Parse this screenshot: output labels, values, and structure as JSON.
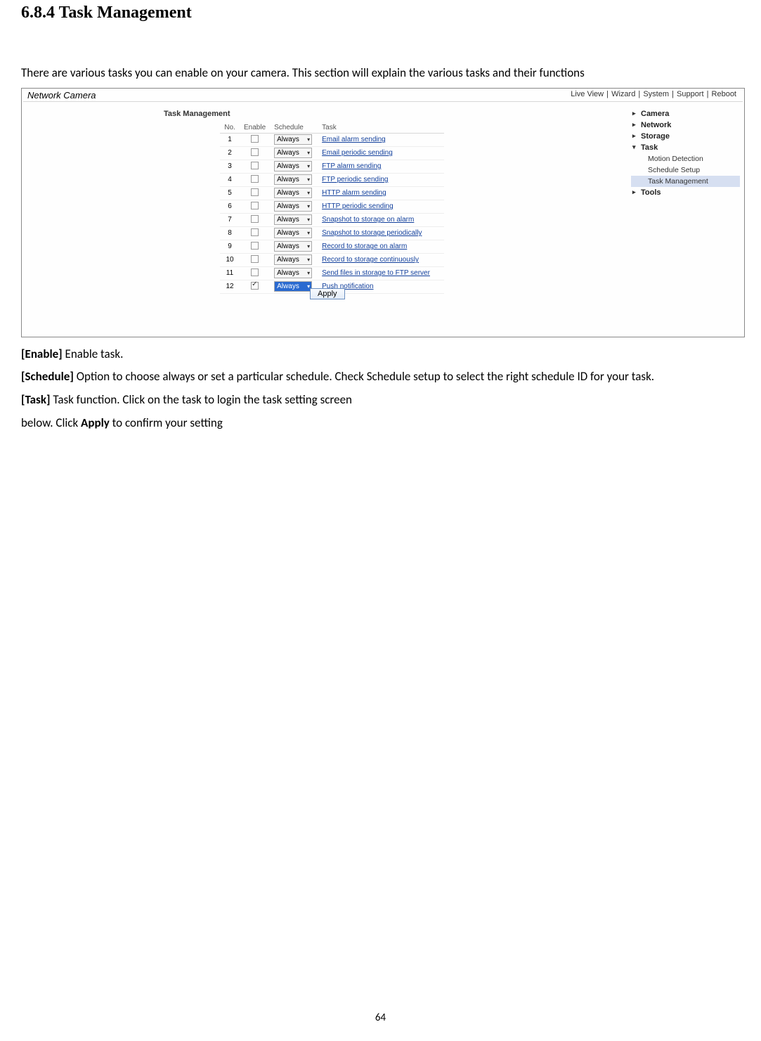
{
  "heading": "6.8.4 Task Management",
  "intro": "There are various tasks you can enable on your camera. This section will explain the various tasks and their functions",
  "screenshot": {
    "title": "Network Camera",
    "topnav": [
      "Live View",
      "Wizard",
      "System",
      "Support",
      "Reboot"
    ],
    "panel_title": "Task Management",
    "columns": {
      "no": "No.",
      "enable": "Enable",
      "schedule": "Schedule",
      "task": "Task"
    },
    "rows": [
      {
        "no": "1",
        "checked": false,
        "selected": false,
        "schedule": "Always",
        "task": "Email alarm sending"
      },
      {
        "no": "2",
        "checked": false,
        "selected": false,
        "schedule": "Always",
        "task": "Email periodic sending"
      },
      {
        "no": "3",
        "checked": false,
        "selected": false,
        "schedule": "Always",
        "task": "FTP alarm sending"
      },
      {
        "no": "4",
        "checked": false,
        "selected": false,
        "schedule": "Always",
        "task": "FTP periodic sending"
      },
      {
        "no": "5",
        "checked": false,
        "selected": false,
        "schedule": "Always",
        "task": "HTTP alarm sending"
      },
      {
        "no": "6",
        "checked": false,
        "selected": false,
        "schedule": "Always",
        "task": "HTTP periodic sending"
      },
      {
        "no": "7",
        "checked": false,
        "selected": false,
        "schedule": "Always",
        "task": "Snapshot to storage on alarm"
      },
      {
        "no": "8",
        "checked": false,
        "selected": false,
        "schedule": "Always",
        "task": "Snapshot to storage periodically"
      },
      {
        "no": "9",
        "checked": false,
        "selected": false,
        "schedule": "Always",
        "task": "Record to storage on alarm"
      },
      {
        "no": "10",
        "checked": false,
        "selected": false,
        "schedule": "Always",
        "task": "Record to storage continuously"
      },
      {
        "no": "11",
        "checked": false,
        "selected": false,
        "schedule": "Always",
        "task": "Send files in storage to FTP server"
      },
      {
        "no": "12",
        "checked": true,
        "selected": true,
        "schedule": "Always",
        "task": "Push notification"
      }
    ],
    "apply": "Apply",
    "sidebar": {
      "camera": "Camera",
      "network": "Network",
      "storage": "Storage",
      "task": "Task",
      "task_sub": [
        "Motion Detection",
        "Schedule Setup",
        "Task Management"
      ],
      "tools": "Tools"
    }
  },
  "defs": {
    "enable_label": "[Enable]",
    "enable_text": " Enable task.",
    "schedule_label": "[Schedule]",
    "schedule_text": " Option to choose always or set a particular schedule. Check Schedule setup to select the right schedule ID for your task.",
    "task_label": "[Task]",
    "task_text": " Task function. Click on the task to login the task setting screen",
    "below_text1": "below. Click ",
    "below_bold": "Apply",
    "below_text2": " to confirm your setting"
  },
  "page_number": "64"
}
